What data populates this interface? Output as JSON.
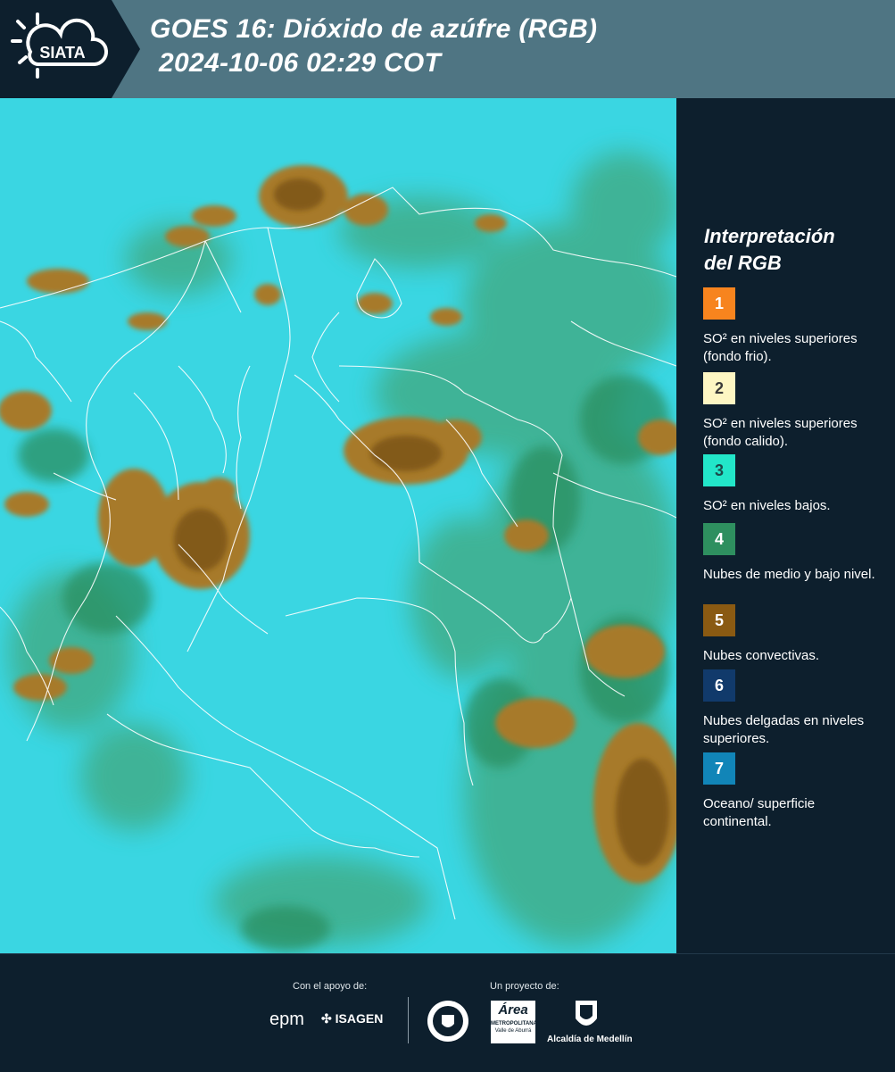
{
  "header": {
    "logo_text": "SIATA",
    "title_line1": "GOES 16: Dióxido de azúfre (RGB)",
    "title_line2": "2024-10-06 02:29 COT"
  },
  "legend": {
    "title_line1": "Interpretación",
    "title_line2": "del RGB",
    "items": [
      {
        "number": "1",
        "color": "#f7841e",
        "text_color": "#ffffff",
        "text": "SO² en niveles superiores (fondo frio)."
      },
      {
        "number": "2",
        "color": "#fdf6c3",
        "text_color": "#3a3a3a",
        "text": "SO² en niveles superiores (fondo calido)."
      },
      {
        "number": "3",
        "color": "#22e6c9",
        "text_color": "#1b4a4a",
        "text": "SO² en niveles bajos."
      },
      {
        "number": "4",
        "color": "#2e8f5f",
        "text_color": "#ffffff",
        "text": "Nubes de medio y bajo nivel."
      },
      {
        "number": "5",
        "color": "#8a5a12",
        "text_color": "#ffffff",
        "text": "Nubes convectivas."
      },
      {
        "number": "6",
        "color": "#113a6b",
        "text_color": "#ffffff",
        "text": "Nubes delgadas en niveles superiores."
      },
      {
        "number": "7",
        "color": "#1185b8",
        "text_color": "#ffffff",
        "text": "Oceano/ superficie continental."
      }
    ]
  },
  "footer": {
    "support_label": "Con el apoyo de:",
    "project_label": "Un proyecto de:",
    "sponsor_epm": "epm",
    "sponsor_isagen": "ISAGEN",
    "partner_area": "Área",
    "partner_area_sub": "METROPOLITANA",
    "partner_area_sub2": "Valle de Aburrá",
    "partner_alcaldia": "Alcaldía de Medellín"
  }
}
